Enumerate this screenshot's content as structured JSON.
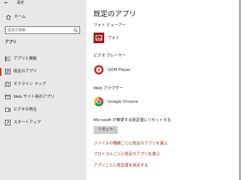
{
  "window": {
    "title": "設定"
  },
  "sidebar": {
    "home_label": "ホーム",
    "search_placeholder": "設定の検索",
    "section_label": "アプリ",
    "items": [
      {
        "label": "アプリと機能",
        "icon": "list-icon"
      },
      {
        "label": "既定のアプリ",
        "icon": "default-apps-icon",
        "active": true
      },
      {
        "label": "オフライン マップ",
        "icon": "map-icon"
      },
      {
        "label": "Web サイト用のアプリ",
        "icon": "website-apps-icon"
      },
      {
        "label": "ビデオの再生",
        "icon": "video-icon"
      },
      {
        "label": "スタートアップ",
        "icon": "startup-icon"
      }
    ]
  },
  "main": {
    "title": "既定のアプリ",
    "categories": [
      {
        "label": "フォト ビューアー",
        "app": "フォト",
        "icon": "photos-app-icon"
      },
      {
        "label": "ビデオ プレーヤー",
        "app": "GOM Player",
        "icon": "gom-player-icon"
      },
      {
        "label": "Web ブラウザー",
        "app": "Google Chrome",
        "icon": "chrome-icon"
      }
    ],
    "reset_text": "Microsoft が推奨する既定値にリセットする",
    "reset_button": "リセット",
    "links": [
      "ファイルの種類ごとに既定のアプリを選ぶ",
      "プロトコルごとに既定のアプリを選ぶ",
      "アプリごとに既定値を設定する"
    ]
  },
  "colors": {
    "accent": "#c0392b",
    "link": "#a4262c",
    "sidebar_bg": "#e8e8e8"
  }
}
